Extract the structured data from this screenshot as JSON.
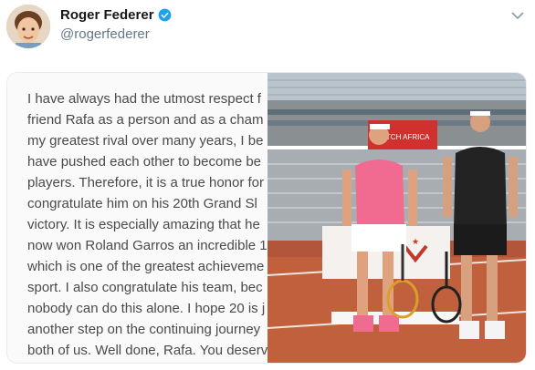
{
  "tweet": {
    "author_name": "Roger Federer",
    "author_handle": "@rogerfederer",
    "verified": true
  },
  "statement_lines": [
    "I have always had the utmost respect f",
    "friend Rafa as a person and as a cham",
    "my greatest rival over many years, I be",
    "have pushed each other to become be",
    "players. Therefore, it is a true honor for",
    "congratulate him on his 20th Grand Sl",
    "victory. It is especially amazing that he",
    "now won Roland Garros an incredible 1",
    "which is one of the greatest achieveme",
    "sport. I also congratulate his team, bec",
    "nobody can do this alone. I hope 20 is j",
    "another step on the continuing journey",
    "both of us. Well done, Rafa. You deserv"
  ],
  "photo": {
    "stadium_board_text": "MATCH AFRICA"
  },
  "colors": {
    "verified_blue": "#1da1f2",
    "clay": "#c0603d",
    "pink_shirt": "#f06b8f"
  }
}
